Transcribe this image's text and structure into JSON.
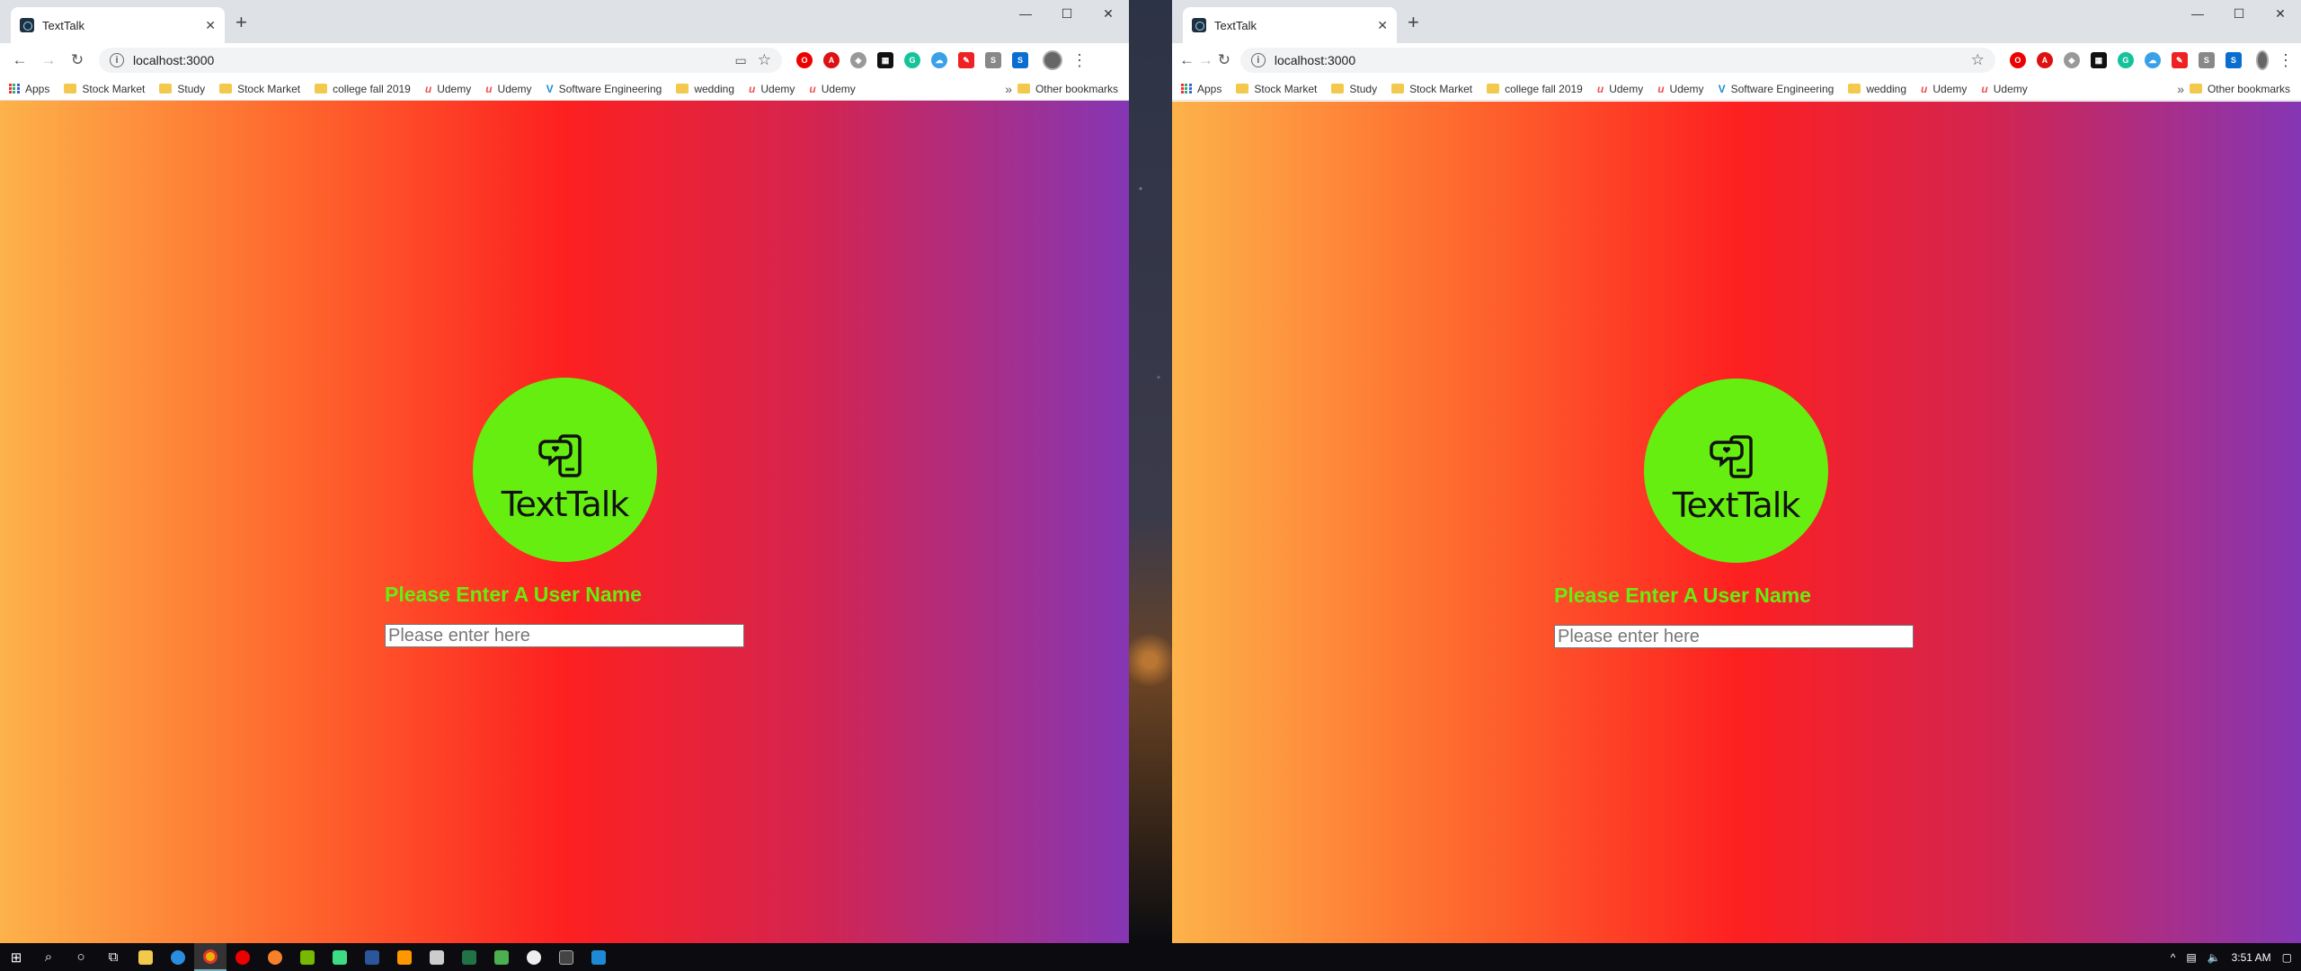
{
  "tab_title": "TextTalk",
  "url": "localhost:3000",
  "bookmarks": {
    "apps": "Apps",
    "stock_market_1": "Stock Market",
    "study": "Study",
    "stock_market_2": "Stock Market",
    "college": "college fall 2019",
    "udemy_1": "Udemy",
    "udemy_2": "Udemy",
    "software_engineering": "Software Engineering",
    "wedding": "wedding",
    "udemy_3": "Udemy",
    "udemy_4": "Udemy",
    "more": "»",
    "other": "Other bookmarks"
  },
  "logo_text": "TextTalk",
  "prompt": "Please Enter A User Name",
  "input_placeholder": "Please enter here",
  "clock": "3:51 AM",
  "colors": {
    "accent_green": "#66ee11",
    "gradient": [
      "#fdb24a",
      "#fe6a2e",
      "#fd2020",
      "#d4244f",
      "#8536b5"
    ]
  },
  "icons": [
    "back-icon",
    "forward-icon",
    "reload-icon",
    "star-icon",
    "info-icon",
    "close-icon",
    "plus-icon",
    "phone-chat-icon"
  ]
}
